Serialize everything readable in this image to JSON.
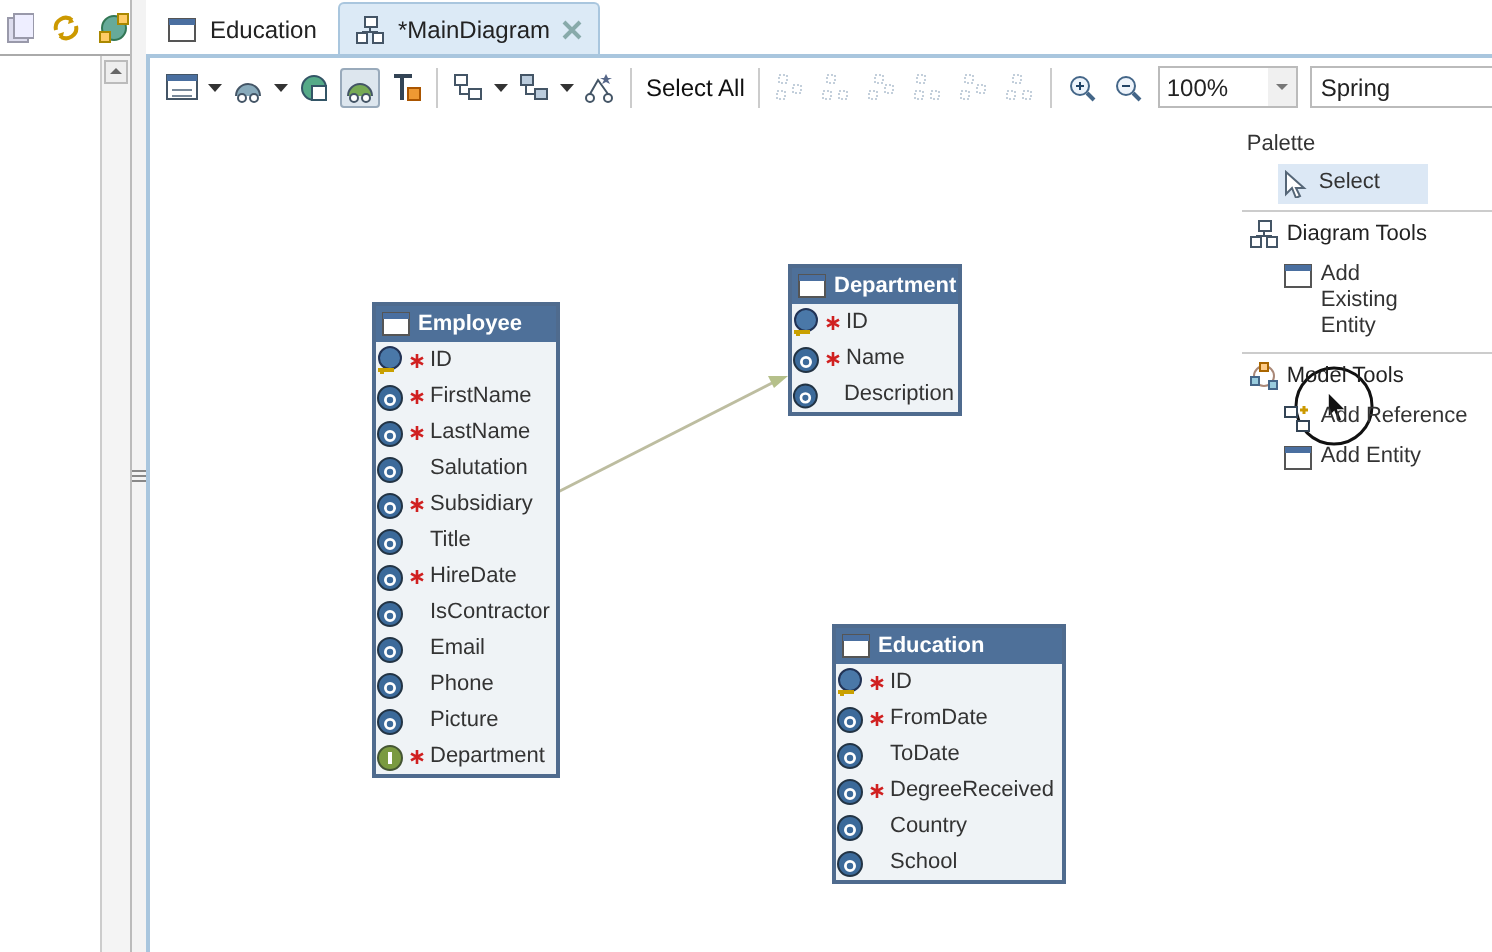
{
  "tabs": [
    {
      "label": "Education",
      "selected": false,
      "closable": false
    },
    {
      "label": "*MainDiagram",
      "selected": true,
      "closable": true
    }
  ],
  "toolbar": {
    "buttons": [
      {
        "dropdown": true,
        "pressed": false,
        "disabled": false
      },
      {
        "dropdown": true,
        "pressed": false,
        "disabled": false
      },
      {
        "dropdown": false,
        "pressed": false,
        "disabled": false
      },
      {
        "dropdown": false,
        "pressed": true,
        "disabled": false
      },
      {
        "dropdown": false,
        "pressed": false,
        "disabled": false
      },
      {
        "dropdown": true,
        "pressed": false,
        "disabled": false
      },
      {
        "dropdown": true,
        "pressed": false,
        "disabled": false
      },
      {
        "dropdown": false,
        "pressed": false,
        "disabled": false
      }
    ],
    "select_all": "Select All",
    "layout_buttons": [
      {
        "disabled": true
      },
      {
        "disabled": true
      },
      {
        "disabled": true
      },
      {
        "disabled": true
      },
      {
        "disabled": true
      },
      {
        "disabled": true
      }
    ],
    "zoom": "100%",
    "layout": "Spring"
  },
  "entities": [
    {
      "name": "Employee",
      "attributes": [
        {
          "name": "ID",
          "kind": "key",
          "required": true
        },
        {
          "name": "FirstName",
          "kind": "attr",
          "required": true
        },
        {
          "name": "LastName",
          "kind": "attr",
          "required": true
        },
        {
          "name": "Salutation",
          "kind": "attr",
          "required": false
        },
        {
          "name": "Subsidiary",
          "kind": "attr",
          "required": true
        },
        {
          "name": "Title",
          "kind": "attr",
          "required": false
        },
        {
          "name": "HireDate",
          "kind": "attr",
          "required": true
        },
        {
          "name": "IsContractor",
          "kind": "attr",
          "required": false
        },
        {
          "name": "Email",
          "kind": "attr",
          "required": false
        },
        {
          "name": "Phone",
          "kind": "attr",
          "required": false
        },
        {
          "name": "Picture",
          "kind": "attr",
          "required": false
        },
        {
          "name": "Department",
          "kind": "ref",
          "required": true
        }
      ]
    },
    {
      "name": "Department",
      "attributes": [
        {
          "name": "ID",
          "kind": "key",
          "required": true
        },
        {
          "name": "Name",
          "kind": "attr",
          "required": true
        },
        {
          "name": "Description",
          "kind": "attr",
          "required": false
        }
      ]
    },
    {
      "name": "Education",
      "attributes": [
        {
          "name": "ID",
          "kind": "key",
          "required": true
        },
        {
          "name": "FromDate",
          "kind": "attr",
          "required": true
        },
        {
          "name": "ToDate",
          "kind": "attr",
          "required": false
        },
        {
          "name": "DegreeReceived",
          "kind": "attr",
          "required": true
        },
        {
          "name": "Country",
          "kind": "attr",
          "required": false
        },
        {
          "name": "School",
          "kind": "attr",
          "required": false
        }
      ]
    }
  ],
  "palette": [
    {
      "kind": "title",
      "label": "Palette"
    },
    {
      "kind": "tool",
      "label": "Select",
      "selected": true
    },
    {
      "kind": "drawer",
      "label": "Diagram Tools"
    },
    {
      "kind": "tool",
      "label": "Add Existing Entity",
      "selected": false
    },
    {
      "kind": "drawer",
      "label": "Model Tools"
    },
    {
      "kind": "tool",
      "label": "Add Reference",
      "selected": false
    },
    {
      "kind": "tool",
      "label": "Add Entity",
      "selected": false
    }
  ]
}
